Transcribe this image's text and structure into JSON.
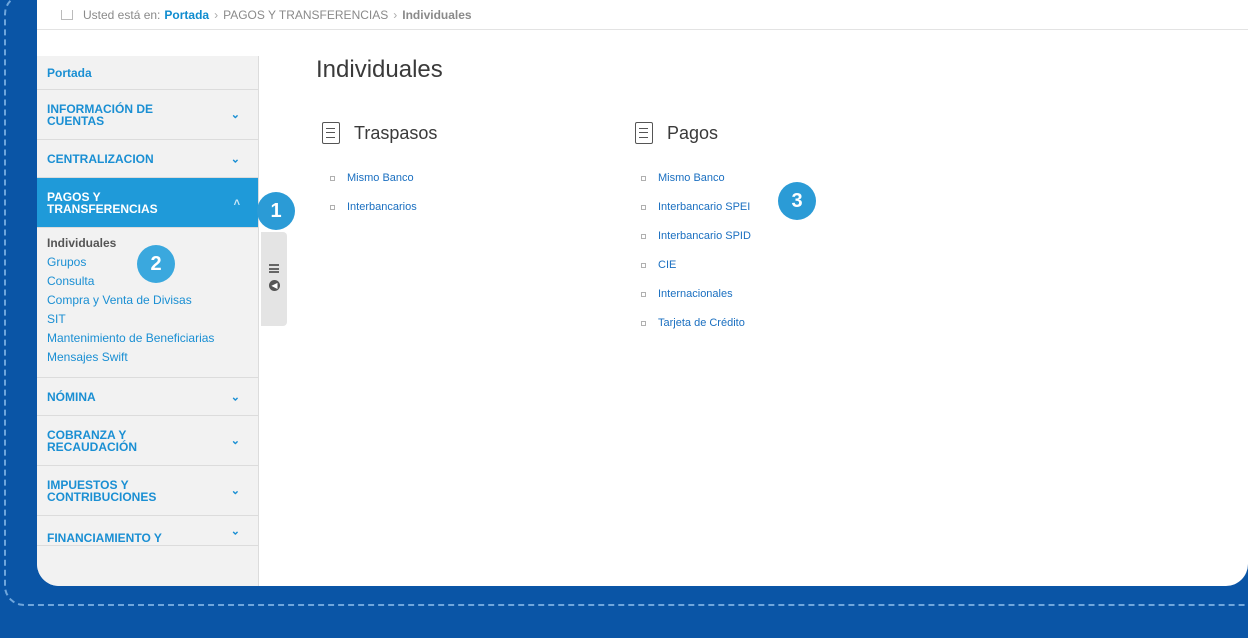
{
  "breadcrumb": {
    "prefix": "Usted está en:",
    "home": "Portada",
    "section": "PAGOS Y TRANSFERENCIAS",
    "current": "Individuales"
  },
  "sidebar": {
    "portada": "Portada",
    "items": [
      {
        "label_line1": "INFORMACIÓN DE",
        "label_line2": "CUENTAS",
        "chevron": "v"
      },
      {
        "label": "CENTRALIZACION",
        "chevron": "v"
      },
      {
        "label_line1": "PAGOS Y",
        "label_line2": "TRANSFERENCIAS",
        "chevron": "^"
      },
      {
        "label": "NÓMINA",
        "chevron": "v"
      },
      {
        "label_line1": "COBRANZA Y",
        "label_line2": "RECAUDACIÓN",
        "chevron": "v"
      },
      {
        "label_line1": "IMPUESTOS Y",
        "label_line2": "CONTRIBUCIONES",
        "chevron": "v"
      },
      {
        "label": "FINANCIAMIENTO Y",
        "chevron": "v"
      }
    ],
    "submenu": [
      "Individuales",
      "Grupos",
      "Consulta",
      "Compra y Venta de Divisas",
      "SIT",
      "Mantenimiento de Beneficiarias",
      "Mensajes Swift"
    ]
  },
  "main": {
    "title": "Individuales",
    "traspasos": {
      "heading": "Traspasos",
      "links": [
        "Mismo Banco",
        "Interbancarios"
      ]
    },
    "pagos": {
      "heading": "Pagos",
      "links": [
        "Mismo Banco",
        "Interbancario SPEI",
        "Interbancario SPID",
        "CIE",
        "Internacionales",
        "Tarjeta de Crédito"
      ]
    }
  },
  "badges": [
    "1",
    "2",
    "3"
  ],
  "colors": {
    "background": "#0a55a6",
    "accent": "#1f9ad9",
    "link": "#1a8fd3",
    "badge": "#2b9bd6"
  }
}
